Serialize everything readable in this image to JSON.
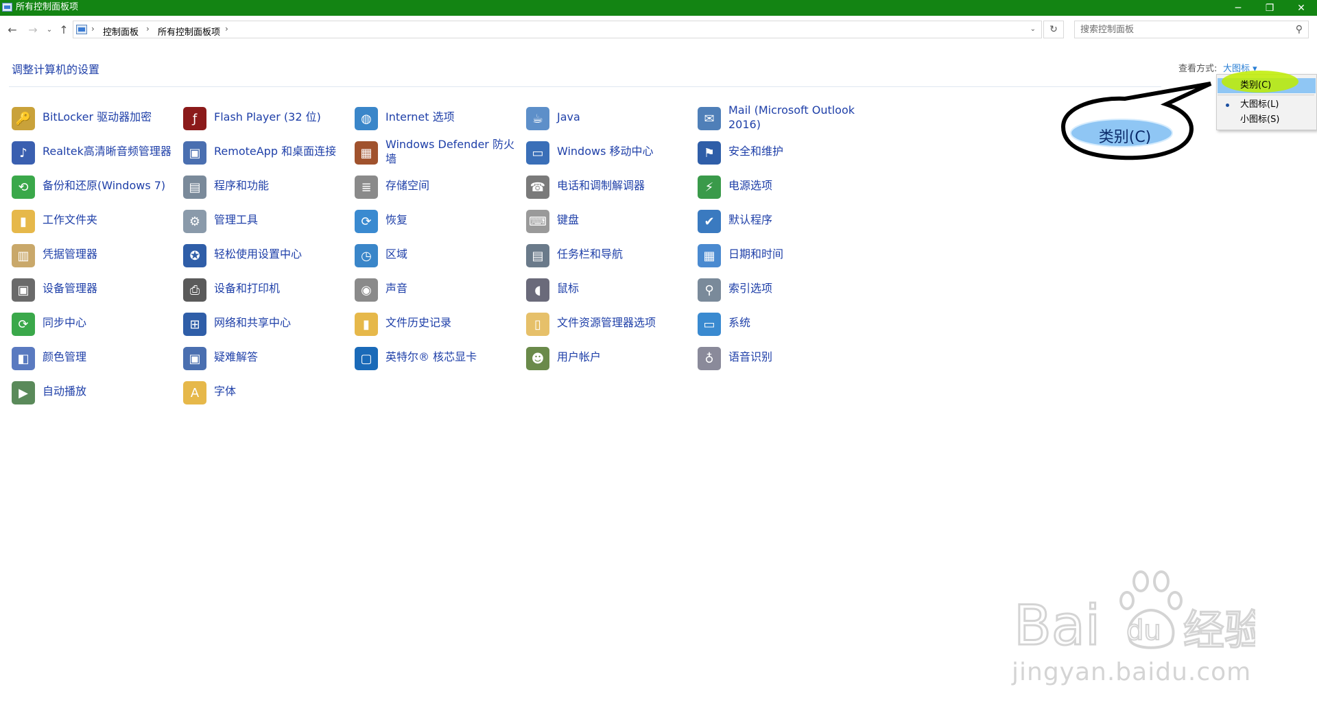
{
  "window": {
    "title": "所有控制面板项",
    "minimize_glyph": "─",
    "maximize_glyph": "❐",
    "close_glyph": "✕"
  },
  "nav": {
    "back_glyph": "←",
    "forward_glyph": "→",
    "recent_glyph": "⌄",
    "up_glyph": "↑",
    "breadcrumbs": [
      "控制面板",
      "所有控制面板项"
    ],
    "crumb_sep": "›",
    "dropdown_glyph": "⌄",
    "refresh_glyph": "↻",
    "search_placeholder": "搜索控制面板",
    "search_glyph": "⚲"
  },
  "header": {
    "title": "调整计算机的设置",
    "view_by_label": "查看方式:",
    "view_by_value": "大图标 ▾"
  },
  "view_menu": {
    "items": [
      {
        "label": "类别(C)",
        "selected": false,
        "highlighted": true
      },
      {
        "label": "大图标(L)",
        "selected": true,
        "highlighted": false
      },
      {
        "label": "小图标(S)",
        "selected": false,
        "highlighted": false
      }
    ]
  },
  "callout": {
    "label": "类别(C)"
  },
  "items": [
    {
      "label": "BitLocker 驱动器加密",
      "icon": "bitlocker-icon",
      "glyph": "🔑",
      "color": "#c9a23a"
    },
    {
      "label": "Flash Player (32 位)",
      "icon": "flash-player-icon",
      "glyph": "ƒ",
      "color": "#8b1a1a"
    },
    {
      "label": "Internet 选项",
      "icon": "internet-options-icon",
      "glyph": "◍",
      "color": "#3a86c9"
    },
    {
      "label": "Java",
      "icon": "java-icon",
      "glyph": "☕",
      "color": "#5d8fc9"
    },
    {
      "label": "Mail (Microsoft Outlook 2016)",
      "icon": "mail-icon",
      "glyph": "✉",
      "color": "#4f7fb8"
    },
    {
      "label": "Realtek高清晰音频管理器",
      "icon": "realtek-audio-icon",
      "glyph": "♪",
      "color": "#3a5fb0"
    },
    {
      "label": "RemoteApp 和桌面连接",
      "icon": "remoteapp-icon",
      "glyph": "▣",
      "color": "#4a6fb0"
    },
    {
      "label": "Windows Defender 防火墙",
      "icon": "firewall-icon",
      "glyph": "▦",
      "color": "#a0522d"
    },
    {
      "label": "Windows 移动中心",
      "icon": "mobility-center-icon",
      "glyph": "▭",
      "color": "#3a6fb8"
    },
    {
      "label": "安全和维护",
      "icon": "security-flag-icon",
      "glyph": "⚑",
      "color": "#2f5ea8"
    },
    {
      "label": "备份和还原(Windows 7)",
      "icon": "backup-restore-icon",
      "glyph": "⟲",
      "color": "#3aa84a"
    },
    {
      "label": "程序和功能",
      "icon": "programs-features-icon",
      "glyph": "▤",
      "color": "#7a8a9a"
    },
    {
      "label": "存储空间",
      "icon": "storage-spaces-icon",
      "glyph": "≣",
      "color": "#8a8a8a"
    },
    {
      "label": "电话和调制解调器",
      "icon": "phone-modem-icon",
      "glyph": "☎",
      "color": "#7a7a7a"
    },
    {
      "label": "电源选项",
      "icon": "power-options-icon",
      "glyph": "⚡",
      "color": "#3a9a4a"
    },
    {
      "label": "工作文件夹",
      "icon": "work-folders-icon",
      "glyph": "▮",
      "color": "#e6b84a"
    },
    {
      "label": "管理工具",
      "icon": "admin-tools-icon",
      "glyph": "⚙",
      "color": "#8a9aaa"
    },
    {
      "label": "恢复",
      "icon": "recovery-icon",
      "glyph": "⟳",
      "color": "#3a8ad0"
    },
    {
      "label": "键盘",
      "icon": "keyboard-icon",
      "glyph": "⌨",
      "color": "#9a9a9a"
    },
    {
      "label": "默认程序",
      "icon": "default-programs-icon",
      "glyph": "✔",
      "color": "#3a7ac0"
    },
    {
      "label": "凭据管理器",
      "icon": "credential-manager-icon",
      "glyph": "▥",
      "color": "#c9a86a"
    },
    {
      "label": "轻松使用设置中心",
      "icon": "ease-of-access-icon",
      "glyph": "✪",
      "color": "#2f5ea8"
    },
    {
      "label": "区域",
      "icon": "region-icon",
      "glyph": "◷",
      "color": "#3a86c9"
    },
    {
      "label": "任务栏和导航",
      "icon": "taskbar-icon",
      "glyph": "▤",
      "color": "#6a7a8a"
    },
    {
      "label": "日期和时间",
      "icon": "date-time-icon",
      "glyph": "▦",
      "color": "#4a8ad0"
    },
    {
      "label": "设备管理器",
      "icon": "device-manager-icon",
      "glyph": "▣",
      "color": "#6a6a6a"
    },
    {
      "label": "设备和打印机",
      "icon": "devices-printers-icon",
      "glyph": "⎙",
      "color": "#5a5a5a"
    },
    {
      "label": "声音",
      "icon": "sound-icon",
      "glyph": "◉",
      "color": "#8a8a8a"
    },
    {
      "label": "鼠标",
      "icon": "mouse-icon",
      "glyph": "◖",
      "color": "#6a6a7a"
    },
    {
      "label": "索引选项",
      "icon": "indexing-options-icon",
      "glyph": "⚲",
      "color": "#7a8a9a"
    },
    {
      "label": "同步中心",
      "icon": "sync-center-icon",
      "glyph": "⟳",
      "color": "#3aa84a"
    },
    {
      "label": "网络和共享中心",
      "icon": "network-sharing-icon",
      "glyph": "⊞",
      "color": "#2f5ea8"
    },
    {
      "label": "文件历史记录",
      "icon": "file-history-icon",
      "glyph": "▮",
      "color": "#e6b84a"
    },
    {
      "label": "文件资源管理器选项",
      "icon": "explorer-options-icon",
      "glyph": "▯",
      "color": "#e6c06a"
    },
    {
      "label": "系统",
      "icon": "system-icon",
      "glyph": "▭",
      "color": "#3a8ad0"
    },
    {
      "label": "颜色管理",
      "icon": "color-management-icon",
      "glyph": "◧",
      "color": "#5a7ac0"
    },
    {
      "label": "疑难解答",
      "icon": "troubleshooting-icon",
      "glyph": "▣",
      "color": "#4a6fb0"
    },
    {
      "label": "英特尔® 核芯显卡",
      "icon": "intel-graphics-icon",
      "glyph": "▢",
      "color": "#1a6ab8"
    },
    {
      "label": "用户帐户",
      "icon": "user-accounts-icon",
      "glyph": "☻",
      "color": "#6a8a4a"
    },
    {
      "label": "语音识别",
      "icon": "speech-recognition-icon",
      "glyph": "♁",
      "color": "#8a8a9a"
    },
    {
      "label": "自动播放",
      "icon": "autoplay-icon",
      "glyph": "▶",
      "color": "#5a8a5a"
    },
    {
      "label": "字体",
      "icon": "fonts-icon",
      "glyph": "A",
      "color": "#e6b84a"
    }
  ],
  "watermark": {
    "text": "jingyan.baidu.com"
  }
}
